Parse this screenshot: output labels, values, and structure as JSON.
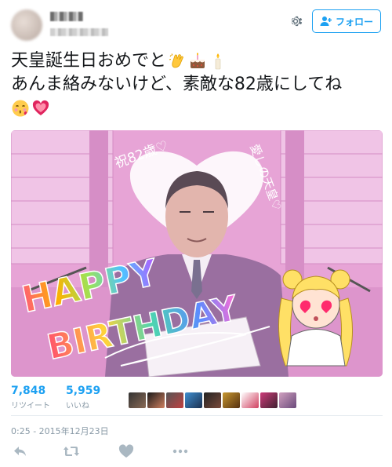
{
  "header": {
    "follow_label": "フォロー"
  },
  "tweet": {
    "line1": "天皇誕生日おめでと",
    "line2": "あんま絡みないけど、素敵な82歳にしてね",
    "emojis_line1": [
      "clapping-hands-emoji",
      "birthday-cake-emoji",
      "candle-emoji"
    ],
    "emojis_line3": [
      "kissing-face-emoji",
      "heart-emoji"
    ]
  },
  "photo": {
    "text_top_left": "祝82歳♡",
    "text_right": "愛しの天皇♡",
    "text_happy": "HAPPY",
    "text_birthday": "BIRTHDAY"
  },
  "stats": {
    "retweets_count": "7,848",
    "retweets_label": "リツイート",
    "likes_count": "5,959",
    "likes_label": "いいね"
  },
  "meta": {
    "timestamp": "0:25 - 2015年12月23日"
  },
  "colors": {
    "accent": "#1da1f2",
    "muted": "#8899a6",
    "icon": "#aab8c2"
  }
}
